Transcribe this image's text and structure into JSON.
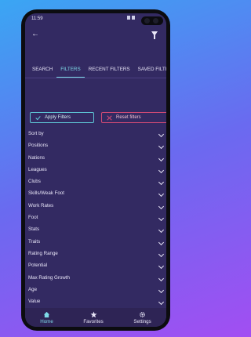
{
  "status_bar": {
    "time": "11:59"
  },
  "tabs": [
    {
      "label": "SEARCH"
    },
    {
      "label": "FILTERS",
      "active": true
    },
    {
      "label": "RECENT FILTERS"
    },
    {
      "label": "SAVED FILTE"
    }
  ],
  "actions": {
    "apply_label": "Apply Filters",
    "reset_label": "Reset filters"
  },
  "filters": [
    "Sort by",
    "Positions",
    "Nations",
    "Leagues",
    "Clubs",
    "Skills/Weak Foot",
    "Work Rates",
    "Foot",
    "Stats",
    "Traits",
    "Rating Range",
    "Potential",
    "Max Rating Growth",
    "Age",
    "Value"
  ],
  "bottom_nav": [
    {
      "label": "Home",
      "icon": "home-icon",
      "active": true
    },
    {
      "label": "Favorites",
      "icon": "star-icon"
    },
    {
      "label": "Settings",
      "icon": "gear-icon"
    }
  ],
  "colors": {
    "accent": "#7fdbe8",
    "apply": "#5ec7d6",
    "reset": "#d24a75",
    "bg": "#332a62"
  }
}
